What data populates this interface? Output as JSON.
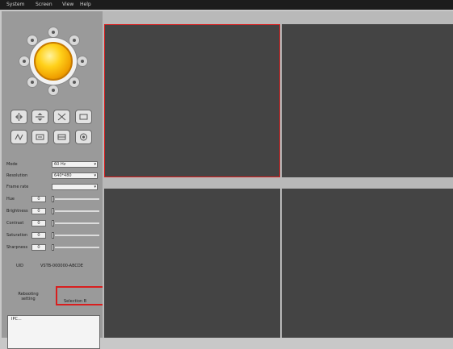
{
  "menu": [
    "System",
    "Screen",
    "View",
    "Help"
  ],
  "ptz": {
    "center_icon": "yellow-ball-icon",
    "direction_icons": [
      "up-arrow-icon",
      "up-right-arrow-icon",
      "right-arrow-icon",
      "down-right-arrow-icon",
      "down-arrow-icon",
      "down-left-arrow-icon",
      "left-arrow-icon",
      "up-left-arrow-icon"
    ]
  },
  "control_buttons": [
    {
      "icon": "flip-vertical-icon"
    },
    {
      "icon": "flip-horizontal-icon"
    },
    {
      "icon": "cruise-icon"
    },
    {
      "icon": "stop-cruise-icon"
    },
    {
      "icon": "io-output-icon"
    },
    {
      "icon": "ir-on-icon"
    },
    {
      "icon": "ir-off-icon"
    },
    {
      "icon": "record-icon"
    }
  ],
  "settings": {
    "mode_label": "Mode",
    "mode_value": "60 Hz",
    "resolution_label": "Resolution",
    "resolution_value": "640*480",
    "framerate_label": "Frame rate",
    "framerate_value": ""
  },
  "sliders": [
    {
      "label": "Hue",
      "value": "0"
    },
    {
      "label": "Brightness",
      "value": "0"
    },
    {
      "label": "Contrast",
      "value": "0"
    },
    {
      "label": "Saturation",
      "value": "0"
    },
    {
      "label": "Sharpness",
      "value": "0"
    }
  ],
  "uid": {
    "label": "UID",
    "value": "VSTB-000000-ABCDE"
  },
  "reboot_label": "Rebooting setting",
  "selection_label": "Selection B",
  "device_list": {
    "item": "IPC..."
  },
  "colors": {
    "highlight": "#d81e1e",
    "video_bg": "#444444",
    "panel_bg": "#9a9a9a"
  }
}
